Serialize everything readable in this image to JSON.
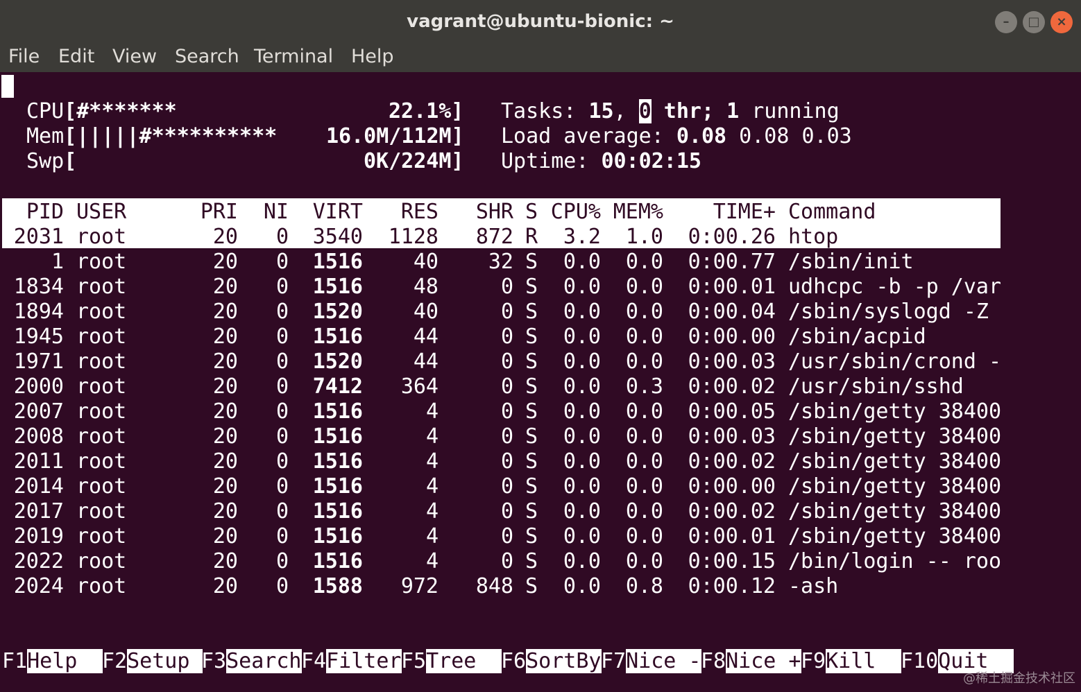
{
  "window": {
    "title": "vagrant@ubuntu-bionic: ~",
    "minimize_glyph": "–",
    "maximize_glyph": "□",
    "close_glyph": "×"
  },
  "menu": [
    "File",
    "Edit",
    "View",
    "Search",
    "Terminal",
    "Help"
  ],
  "meters": {
    "cpu": {
      "label": "CPU",
      "bar": "[#*******",
      "value": "22.1%]"
    },
    "mem": {
      "label": "Mem",
      "bar": "[|||||#**********",
      "value": "16.0M/112M]"
    },
    "swp": {
      "label": "Swp",
      "bar": "[",
      "value": "0K/224M]"
    }
  },
  "tasks": {
    "label": "Tasks: ",
    "count": "15",
    "sep": ", ",
    "thr": "0",
    "thr_label": " thr; ",
    "running": "1",
    "running_label": " running"
  },
  "load": {
    "label": "Load average: ",
    "l1": "0.08",
    "l5": " 0.08",
    "l15": " 0.03"
  },
  "uptime": {
    "label": "Uptime: ",
    "value": "00:02:15"
  },
  "columns": [
    "PID",
    "USER",
    "PRI",
    "NI",
    "VIRT",
    "RES",
    "SHR",
    "S",
    "CPU%",
    "MEM%",
    "TIME+",
    "Command"
  ],
  "processes": [
    [
      "2031",
      "root",
      "20",
      "0",
      "3540",
      "1128",
      "872",
      "R",
      "3.2",
      "1.0",
      "0:00.26",
      "htop"
    ],
    [
      "1",
      "root",
      "20",
      "0",
      "1516",
      "40",
      "32",
      "S",
      "0.0",
      "0.0",
      "0:00.77",
      "/sbin/init"
    ],
    [
      "1834",
      "root",
      "20",
      "0",
      "1516",
      "48",
      "0",
      "S",
      "0.0",
      "0.0",
      "0:00.01",
      "udhcpc -b -p /var"
    ],
    [
      "1894",
      "root",
      "20",
      "0",
      "1520",
      "40",
      "0",
      "S",
      "0.0",
      "0.0",
      "0:00.04",
      "/sbin/syslogd -Z"
    ],
    [
      "1945",
      "root",
      "20",
      "0",
      "1516",
      "44",
      "0",
      "S",
      "0.0",
      "0.0",
      "0:00.00",
      "/sbin/acpid"
    ],
    [
      "1971",
      "root",
      "20",
      "0",
      "1520",
      "44",
      "0",
      "S",
      "0.0",
      "0.0",
      "0:00.03",
      "/usr/sbin/crond -"
    ],
    [
      "2000",
      "root",
      "20",
      "0",
      "7412",
      "364",
      "0",
      "S",
      "0.0",
      "0.3",
      "0:00.02",
      "/usr/sbin/sshd"
    ],
    [
      "2007",
      "root",
      "20",
      "0",
      "1516",
      "4",
      "0",
      "S",
      "0.0",
      "0.0",
      "0:00.05",
      "/sbin/getty 38400"
    ],
    [
      "2008",
      "root",
      "20",
      "0",
      "1516",
      "4",
      "0",
      "S",
      "0.0",
      "0.0",
      "0:00.03",
      "/sbin/getty 38400"
    ],
    [
      "2011",
      "root",
      "20",
      "0",
      "1516",
      "4",
      "0",
      "S",
      "0.0",
      "0.0",
      "0:00.02",
      "/sbin/getty 38400"
    ],
    [
      "2014",
      "root",
      "20",
      "0",
      "1516",
      "4",
      "0",
      "S",
      "0.0",
      "0.0",
      "0:00.00",
      "/sbin/getty 38400"
    ],
    [
      "2017",
      "root",
      "20",
      "0",
      "1516",
      "4",
      "0",
      "S",
      "0.0",
      "0.0",
      "0:00.02",
      "/sbin/getty 38400"
    ],
    [
      "2019",
      "root",
      "20",
      "0",
      "1516",
      "4",
      "0",
      "S",
      "0.0",
      "0.0",
      "0:00.01",
      "/sbin/getty 38400"
    ],
    [
      "2022",
      "root",
      "20",
      "0",
      "1516",
      "4",
      "0",
      "S",
      "0.0",
      "0.0",
      "0:00.15",
      "/bin/login -- roo"
    ],
    [
      "2024",
      "root",
      "20",
      "0",
      "1588",
      "972",
      "848",
      "S",
      "0.0",
      "0.8",
      "0:00.12",
      "-ash"
    ]
  ],
  "function_keys": [
    {
      "key": "F1",
      "label": "Help  "
    },
    {
      "key": "F2",
      "label": "Setup "
    },
    {
      "key": "F3",
      "label": "Search"
    },
    {
      "key": "F4",
      "label": "Filter"
    },
    {
      "key": "F5",
      "label": "Tree  "
    },
    {
      "key": "F6",
      "label": "SortBy"
    },
    {
      "key": "F7",
      "label": "Nice -"
    },
    {
      "key": "F8",
      "label": "Nice +"
    },
    {
      "key": "F9",
      "label": "Kill  "
    },
    {
      "key": "F10",
      "label": "Quit  "
    }
  ],
  "watermark": "@稀土掘金技术社区",
  "colors": {
    "terminal_bg": "#300a24",
    "chrome": "#3c3b37",
    "close": "#f0683d"
  }
}
